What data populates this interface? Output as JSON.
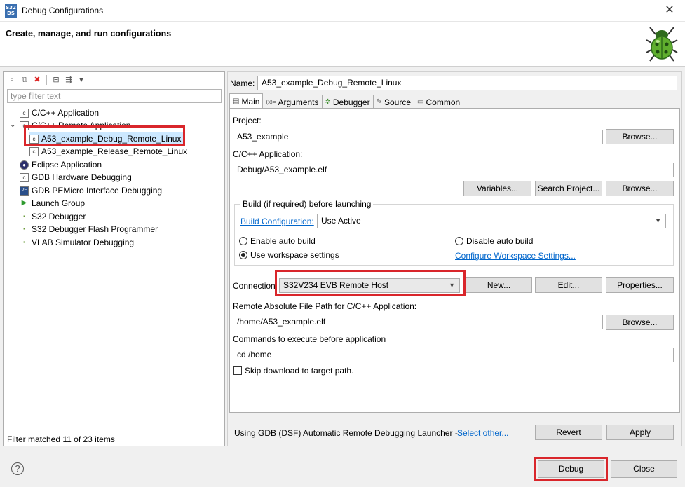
{
  "window": {
    "title": "Debug Configurations",
    "app_icon_text": "S32 DS",
    "close_glyph": "✕"
  },
  "banner": {
    "title": "Create, manage, and run configurations"
  },
  "left": {
    "filter_placeholder": "type filter text",
    "tree": [
      {
        "label": "C/C++ Application",
        "icon": "c-app-icon",
        "glyph": "c"
      },
      {
        "label": "C/C++ Remote Application",
        "icon": "c-remote-icon",
        "glyph": "c",
        "expanded": true
      },
      {
        "label": "A53_example_Debug_Remote_Linux",
        "icon": "c-config-icon",
        "glyph": "c",
        "selected": true
      },
      {
        "label": "A53_example_Release_Remote_Linux",
        "icon": "c-config-icon",
        "glyph": "c"
      },
      {
        "label": "Eclipse Application",
        "icon": "eclipse-icon",
        "glyph": "●"
      },
      {
        "label": "GDB Hardware Debugging",
        "icon": "gdb-icon",
        "glyph": "c"
      },
      {
        "label": "GDB PEMicro Interface Debugging",
        "icon": "pemicro-icon",
        "glyph": "PE"
      },
      {
        "label": "Launch Group",
        "icon": "launch-group-icon",
        "glyph": "▶"
      },
      {
        "label": "S32 Debugger",
        "icon": "s32-debugger-icon",
        "glyph": "▪"
      },
      {
        "label": "S32 Debugger Flash Programmer",
        "icon": "s32-flash-icon",
        "glyph": "▪"
      },
      {
        "label": "VLAB Simulator Debugging",
        "icon": "vlab-icon",
        "glyph": "▪"
      }
    ],
    "status": "Filter matched 11 of 23 items"
  },
  "right": {
    "name_label": "Name:",
    "name_value": "A53_example_Debug_Remote_Linux",
    "tabs": [
      {
        "label": "Main",
        "icon": "▤"
      },
      {
        "label": "Arguments",
        "icon": "(x)="
      },
      {
        "label": "Debugger",
        "icon": "✲"
      },
      {
        "label": "Source",
        "icon": "✎"
      },
      {
        "label": "Common",
        "icon": "▭"
      }
    ],
    "project_label": "Project:",
    "project_value": "A53_example",
    "browse": "Browse...",
    "app_label": "C/C++ Application:",
    "app_value": "Debug/A53_example.elf",
    "variables": "Variables...",
    "search_project": "Search Project...",
    "build_group_title": "Build (if required) before launching",
    "build_config_link": "Build Configuration:",
    "build_config_value": "Use Active",
    "enable_auto_build": "Enable auto build",
    "disable_auto_build": "Disable auto build",
    "use_workspace": "Use workspace settings",
    "configure_workspace": "Configure Workspace Settings...",
    "connection_label": "Connection",
    "connection_value": "S32V234 EVB Remote Host",
    "new": "New...",
    "edit": "Edit...",
    "properties": "Properties...",
    "remote_path_label": "Remote Absolute File Path for C/C++ Application:",
    "remote_path_value": "/home/A53_example.elf",
    "commands_label": "Commands to execute before application",
    "commands_value": "cd /home",
    "skip_download": "Skip download to target path.",
    "launcher_text": "Using GDB (DSF) Automatic Remote Debugging Launcher -",
    "select_other": "Select other...",
    "revert": "Revert",
    "apply": "Apply"
  },
  "footer": {
    "help": "?",
    "debug": "Debug",
    "close": "Close"
  },
  "colors": {
    "highlight": "#d9262b",
    "link": "#0066cc",
    "selection": "#cce8ff"
  }
}
